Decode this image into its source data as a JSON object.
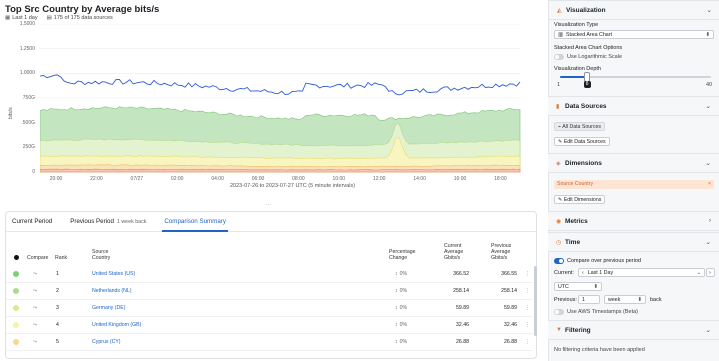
{
  "title": "Top Src Country by Average bits/s",
  "subbar": {
    "range": "Last 1 day",
    "sources": "175 of 175 data sources"
  },
  "chart_data": {
    "type": "area",
    "stacked": true,
    "ylabel": "bits/s",
    "y_ticks": [
      "0",
      "250G",
      "500G",
      "750G",
      "1.0000",
      "1.2500",
      "1.5000"
    ],
    "x_ticks": [
      "20:00",
      "22:00",
      "07/27",
      "02:00",
      "04:00",
      "06:00",
      "08:00",
      "10:00",
      "12:00",
      "14:00",
      "16:00",
      "18:00"
    ],
    "caption": "2023-07-26 to 2023-07-27 UTC (5 minute intervals)",
    "colors": {
      "top_line": "#2f5bd7",
      "band_green": "#c3e6c0",
      "band_green_line": "#7fc27a",
      "band_lightgreen": "#e3f2cf",
      "band_yellow": "#f8f5c0",
      "band_orange": "#fbe3b8",
      "band_red": "#f6c2b5"
    }
  },
  "drag_handle": "⋯",
  "tabs": {
    "current": "Current Period",
    "previous": "Previous Period",
    "previous_sub": "1 week back",
    "comparison": "Comparison Summary"
  },
  "table": {
    "headers": {
      "compare": "Compare",
      "rank": "Rank",
      "source1": "Source",
      "source2": "Country",
      "pct1": "Percentage",
      "pct2": "Change",
      "cur1": "Current",
      "cur2": "Average",
      "cur3": "Gbits/s",
      "prev1": "Previous",
      "prev2": "Average",
      "prev3": "Gbits/s"
    },
    "rows": [
      {
        "color": "#7fcf7a",
        "rank": "1",
        "country": "United States (US)",
        "pct": "0%",
        "current": "366.52",
        "previous": "366.55"
      },
      {
        "color": "#a9dc8e",
        "rank": "2",
        "country": "Netherlands (NL)",
        "pct": "0%",
        "current": "258.14",
        "previous": "258.14"
      },
      {
        "color": "#d6ec8f",
        "rank": "3",
        "country": "Germany (DE)",
        "pct": "0%",
        "current": "59.89",
        "previous": "59.89"
      },
      {
        "color": "#f7f3a8",
        "rank": "4",
        "country": "United Kingdom (GB)",
        "pct": "0%",
        "current": "32.46",
        "previous": "32.46"
      },
      {
        "color": "#f9d68d",
        "rank": "5",
        "country": "Cyprus (CY)",
        "pct": "0%",
        "current": "26.88",
        "previous": "26.88"
      }
    ]
  },
  "sidebar": {
    "visualization": {
      "title": "Visualization",
      "type_label": "Visualization Type",
      "type_value": "Stacked Area Chart",
      "options_label": "Stacked Area Chart Options",
      "log_label": "Use Logarithmic Scale",
      "log_on": false,
      "depth_label": "Visualization Depth",
      "depth_min": "1",
      "depth_value": "8",
      "depth_max": "40"
    },
    "data_sources": {
      "title": "Data Sources",
      "all_button": "All Data Sources",
      "edit_button": "Edit Data Sources"
    },
    "dimensions": {
      "title": "Dimensions",
      "chip": "Source Country",
      "edit_button": "Edit Dimensions"
    },
    "metrics": {
      "title": "Metrics"
    },
    "time": {
      "title": "Time",
      "compare_label": "Compare over previous period",
      "compare_on": true,
      "current_label": "Current:",
      "current_value": "Last 1 Day",
      "tz_value": "UTC",
      "previous_label": "Previous:",
      "previous_num": "1",
      "previous_unit": "week",
      "back_label": "back",
      "aws_label": "Use AWS Timestamps (Beta)",
      "aws_on": false
    },
    "filtering": {
      "title": "Filtering",
      "empty": "No filtering criteria have been applied"
    }
  }
}
